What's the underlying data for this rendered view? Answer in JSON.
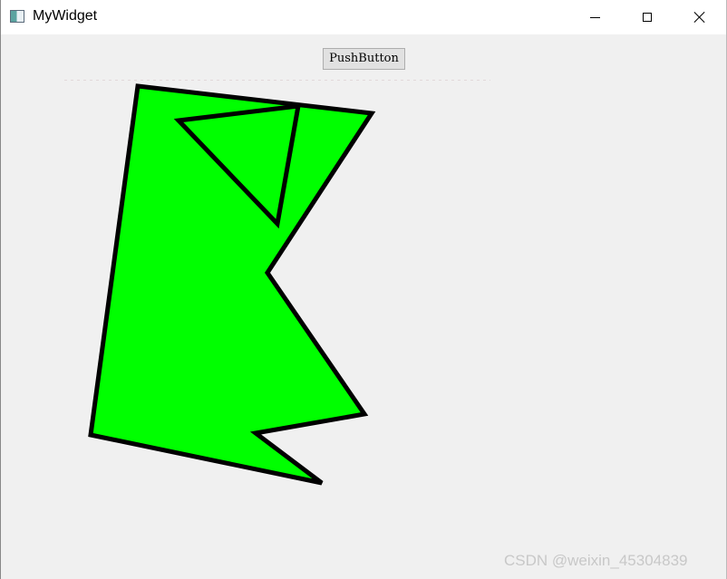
{
  "window": {
    "title": "MyWidget",
    "icon": "qt-window-icon",
    "controls": {
      "minimize": "minimize-icon",
      "maximize": "maximize-icon",
      "close": "close-icon"
    }
  },
  "main": {
    "button_label": "PushButton"
  },
  "drawing": {
    "fill_color": "#00ff00",
    "stroke_color": "#000000"
  },
  "watermark": "CSDN @weixin_45304839"
}
